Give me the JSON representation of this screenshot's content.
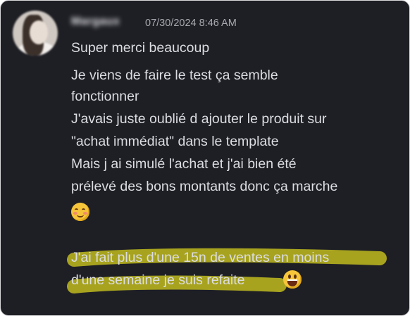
{
  "message": {
    "author": "Margaux",
    "timestamp": "07/30/2024 8:46 AM",
    "lines": [
      "Super merci beaucoup",
      "Je viens de faire le test ça semble",
      "fonctionner",
      "J'avais juste oublié d ajouter le produit sur",
      "\"achat immédiat\" dans le template",
      "Mais j ai simulé l'achat et j'ai bien été",
      "prélevé des bons montants donc ça marche",
      "J'ai fait plus d'une 15n de ventes en moins",
      "d'une semaine je suis refaite"
    ],
    "emojis": {
      "relieved": "relieved-face-icon",
      "grinning": "grinning-face-icon"
    }
  },
  "colors": {
    "background": "#1e1f25",
    "text": "#dcdde2",
    "timestamp": "#a7a8b0",
    "highlight": "#c9c41e"
  }
}
